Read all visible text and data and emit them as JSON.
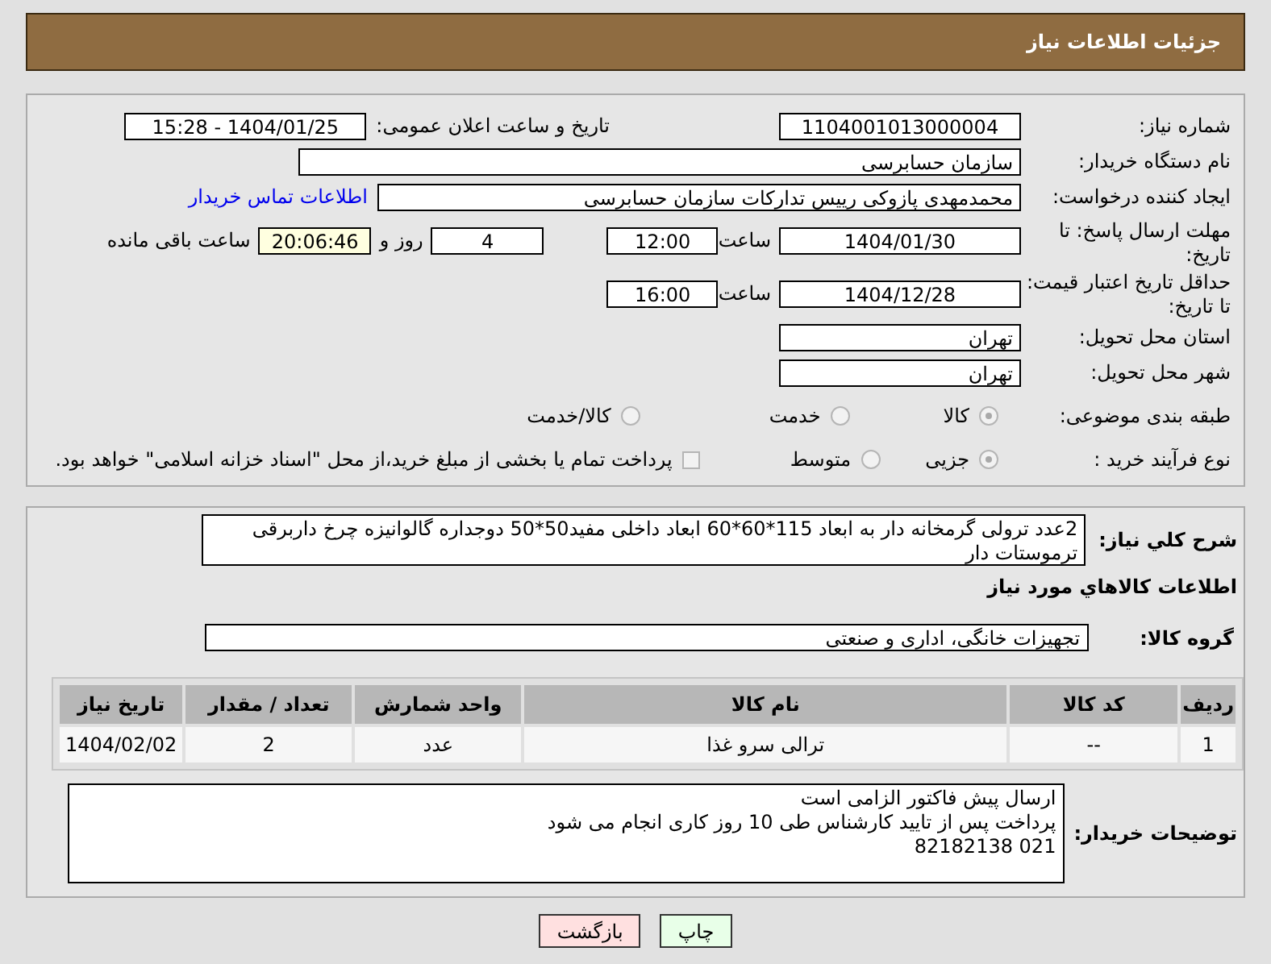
{
  "header": {
    "title": "جزئیات اطلاعات نیاز"
  },
  "need_number": {
    "label": "شماره نیاز:",
    "value": "1104001013000004"
  },
  "announce": {
    "label": "تاریخ و ساعت اعلان عمومی:",
    "value": "1404/01/25 - 15:28"
  },
  "buyer_org": {
    "label": "نام دستگاه خریدار:",
    "value": "سازمان حسابرسی"
  },
  "requester": {
    "label": "ایجاد کننده درخواست:",
    "value": "محمدمهدی پازوکی رییس تدارکات سازمان حسابرسی",
    "link": "اطلاعات تماس خریدار"
  },
  "reply_deadline": {
    "label": "مهلت ارسال پاسخ: تا تاریخ:",
    "date": "1404/01/30",
    "time_label": "ساعت",
    "time": "12:00",
    "days": "4",
    "days_label": "روز و",
    "remaining": "20:06:46",
    "remaining_label": "ساعت باقی مانده"
  },
  "price_validity": {
    "label": "حداقل تاریخ اعتبار قیمت: تا تاریخ:",
    "date": "1404/12/28",
    "time_label": "ساعت",
    "time": "16:00"
  },
  "province": {
    "label": "استان محل تحویل:",
    "value": "تهران"
  },
  "city": {
    "label": "شهر محل تحویل:",
    "value": "تهران"
  },
  "category": {
    "label": "طبقه بندی موضوعی:",
    "options": [
      {
        "label": "کالا",
        "selected": true
      },
      {
        "label": "خدمت",
        "selected": false
      },
      {
        "label": "کالا/خدمت",
        "selected": false
      }
    ]
  },
  "purchase_process": {
    "label": "نوع فرآیند خرید :",
    "options": [
      {
        "label": "جزیی",
        "selected": true
      },
      {
        "label": "متوسط",
        "selected": false
      }
    ],
    "payment_note": {
      "label": "پرداخت تمام یا بخشی از مبلغ خرید،از محل \"اسناد خزانه اسلامی\" خواهد بود.",
      "checked": false
    }
  },
  "description": {
    "label": "شرح کلي نیاز:",
    "value": "2عدد ترولی گرمخانه دار به ابعاد 115*60*60 ابعاد داخلی مفید50*50 دوجداره گالوانیزه چرخ داربرقی ترموستات دار"
  },
  "items_title": "اطلاعات کالاهاي مورد نیاز",
  "goods_group": {
    "label": "گروه کالا:",
    "value": "تجهیزات خانگی، اداری و صنعتی"
  },
  "table": {
    "columns": [
      "ردیف",
      "کد کالا",
      "نام کالا",
      "واحد شمارش",
      "تعداد / مقدار",
      "تاریخ نیاز"
    ],
    "rows": [
      [
        "1",
        "--",
        "ترالی سرو غذا",
        "عدد",
        "2",
        "1404/02/02"
      ]
    ]
  },
  "buyer_notes": {
    "label": "توضیحات خریدار:",
    "lines": [
      "ارسال پیش فاکتور الزامی است",
      "پرداخت پس از تایید کارشناس طی 10 روز کاری انجام می شود",
      "021 82182138"
    ]
  },
  "buttons": [
    {
      "label": "چاپ",
      "kind": "print"
    },
    {
      "label": "بازگشت",
      "kind": "back"
    }
  ]
}
